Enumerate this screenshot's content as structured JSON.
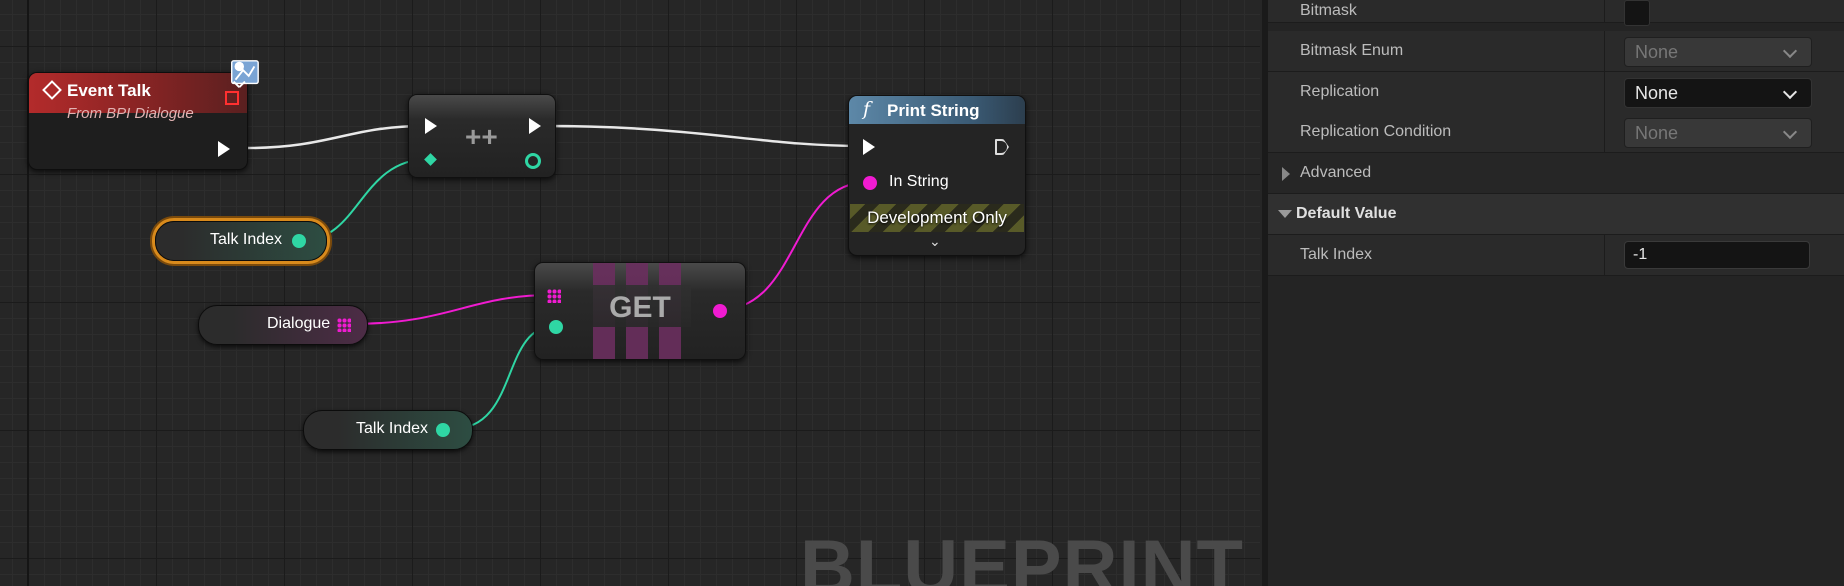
{
  "graph": {
    "watermark": "BLUEPRINT",
    "event_node": {
      "title": "Event Talk",
      "subtitle": "From BPI Dialogue"
    },
    "increment_node": {
      "label": "++"
    },
    "print_node": {
      "title": "Print String",
      "func_glyph": "f",
      "in_string_label": "In String",
      "dev_label": "Development Only",
      "expand_glyph": "⌄"
    },
    "get_node": {
      "label": "GET"
    },
    "vars": {
      "talk_index_1": "Talk Index",
      "dialogue": "Dialogue",
      "talk_index_2": "Talk Index"
    },
    "colors": {
      "exec": "#ffffff",
      "integer": "#2fd6a4",
      "string": "#f01bd1",
      "event_header": "#b32b2b",
      "function_header": "#5d88a8",
      "selection": "#d88a1c"
    }
  },
  "details": {
    "rows": [
      {
        "name": "Bitmask"
      },
      {
        "name": "Bitmask Enum",
        "value": "None"
      },
      {
        "name": "Replication",
        "value": "None"
      },
      {
        "name": "Replication Condition",
        "value": "None"
      }
    ],
    "sections": {
      "advanced": "Advanced",
      "default_value": "Default Value"
    },
    "default_row": {
      "name": "Talk Index",
      "value": "-1"
    }
  }
}
